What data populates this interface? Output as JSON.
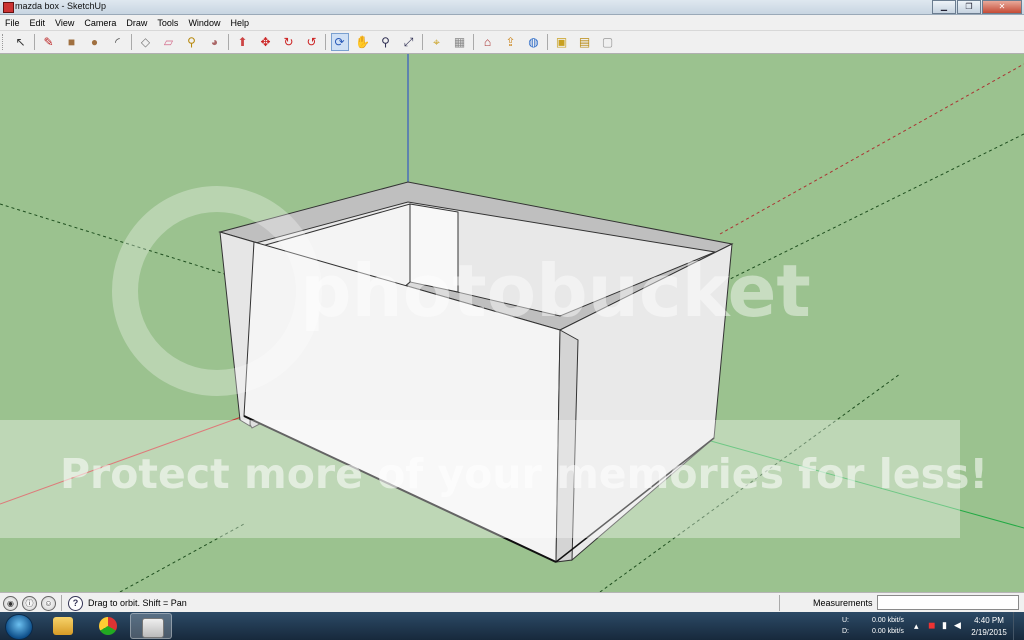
{
  "window": {
    "title": "mazda box - SketchUp",
    "controls": [
      "minimize",
      "restore",
      "close"
    ]
  },
  "menu": [
    "File",
    "Edit",
    "View",
    "Camera",
    "Draw",
    "Tools",
    "Window",
    "Help"
  ],
  "toolbar": {
    "tools": [
      {
        "name": "select-tool",
        "glyph": "↖"
      },
      {
        "name": "pencil-tool",
        "glyph": "✎"
      },
      {
        "name": "rectangle-tool",
        "glyph": "■"
      },
      {
        "name": "circle-tool",
        "glyph": "●"
      },
      {
        "name": "arc-tool",
        "glyph": "◜"
      },
      {
        "name": "make-component-tool",
        "glyph": "◇"
      },
      {
        "name": "eraser-tool",
        "glyph": "▱"
      },
      {
        "name": "tape-measure-tool",
        "glyph": "⚲"
      },
      {
        "name": "paint-bucket-tool",
        "glyph": "◕"
      },
      {
        "name": "push-pull-tool",
        "glyph": "⬆"
      },
      {
        "name": "move-tool",
        "glyph": "✥"
      },
      {
        "name": "rotate-tool",
        "glyph": "↻"
      },
      {
        "name": "offset-tool",
        "glyph": "↺"
      },
      {
        "name": "orbit-tool",
        "glyph": "⟳"
      },
      {
        "name": "pan-tool",
        "glyph": "✋"
      },
      {
        "name": "zoom-tool",
        "glyph": "🔍"
      },
      {
        "name": "zoom-extents-tool",
        "glyph": "⤢"
      },
      {
        "name": "add-location-tool",
        "glyph": "⌖"
      },
      {
        "name": "toggle-terrain-tool",
        "glyph": "▦"
      },
      {
        "name": "get-models-tool",
        "glyph": "⌂"
      },
      {
        "name": "share-model-tool",
        "glyph": "⇪"
      },
      {
        "name": "preview-google-earth-tool",
        "glyph": "◍"
      },
      {
        "name": "get-components-tool",
        "glyph": "▣"
      },
      {
        "name": "share-component-tool",
        "glyph": "▤"
      },
      {
        "name": "extension-warehouse-tool",
        "glyph": "▢"
      }
    ]
  },
  "colors": {
    "viewport_bg": "#9bc28f",
    "box_face": "#f2f2f2",
    "box_shadow": "#d8d8d8",
    "axis_red": "#cc3333",
    "axis_green": "#22aa44",
    "axis_blue": "#2244cc"
  },
  "watermark": {
    "logo": "photobucket",
    "banner": "Protect more of your memories for less!"
  },
  "statusbar": {
    "message": "Drag to orbit.  Shift = Pan",
    "measurements_label": "Measurements",
    "measurements_value": "",
    "status_icons": [
      "geo-location-icon",
      "credits-icon",
      "user-icon"
    ]
  },
  "taskbar": {
    "apps": [
      "windows-explorer",
      "google-chrome",
      "sketchup"
    ],
    "network": {
      "up_label": "U:",
      "up_value": "0.00 kbit/s",
      "down_label": "D:",
      "down_value": "0.00 kbit/s"
    },
    "time": "4:40 PM",
    "date": "2/19/2015"
  }
}
